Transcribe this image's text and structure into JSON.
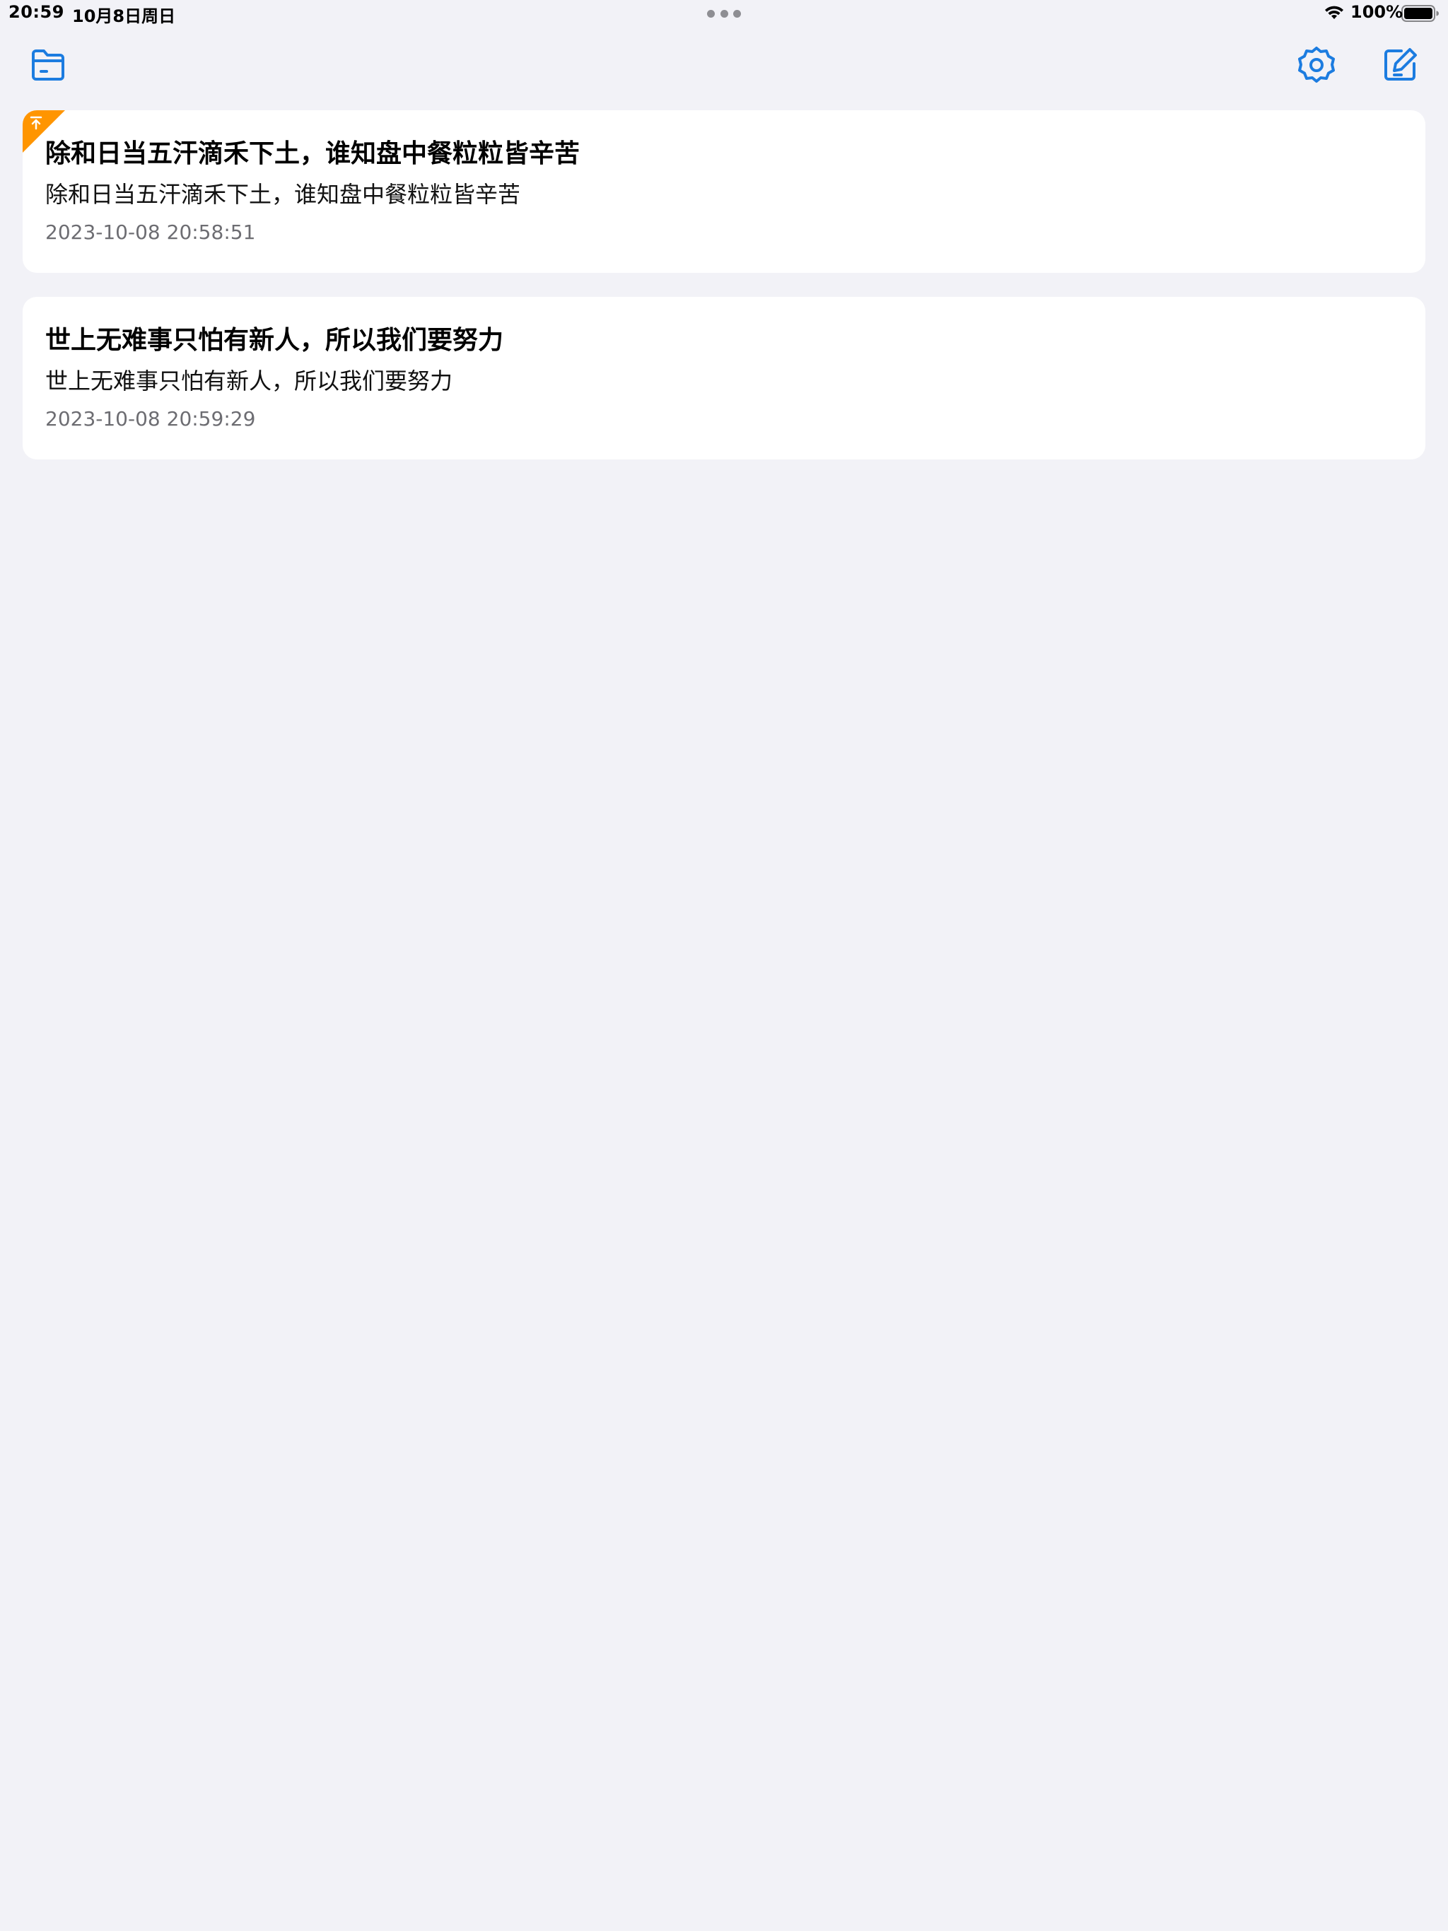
{
  "status_bar": {
    "time": "20:59",
    "date": "10月8日周日",
    "battery": "100%"
  },
  "toolbar": {
    "folder_icon": "folder-icon",
    "settings_icon": "gear-icon",
    "compose_icon": "compose-icon",
    "accent_color": "#1C7CE0"
  },
  "notes": [
    {
      "title": "除和日当五汗滴禾下土，谁知盘中餐粒粒皆辛苦",
      "body": "除和日当五汗滴禾下土，谁知盘中餐粒粒皆辛苦",
      "date": "2023-10-08 20:58:51",
      "pin_icon": "pin-top-icon",
      "pin_color": "#FF9500"
    },
    {
      "title": "世上无难事只怕有新人，所以我们要努力",
      "body": "世上无难事只怕有新人，所以我们要努力",
      "date": "2023-10-08 20:59:29"
    }
  ]
}
